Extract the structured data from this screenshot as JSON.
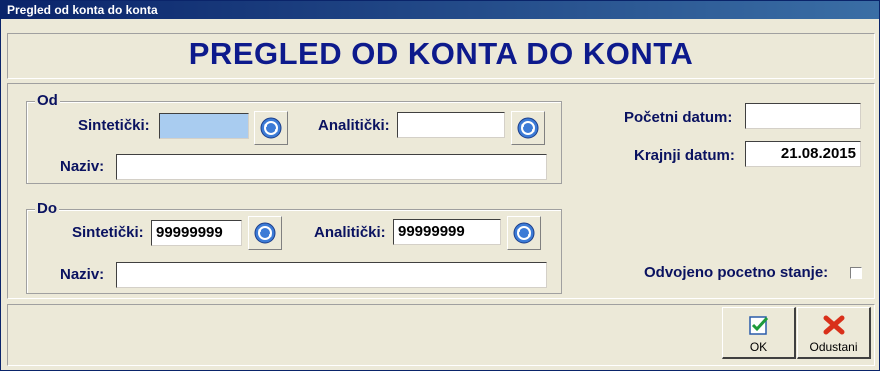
{
  "window": {
    "title": "Pregled od konta do konta"
  },
  "header": {
    "title": "PREGLED OD KONTA DO KONTA"
  },
  "od": {
    "legend": "Od",
    "sinteticki_label": "Sintetički:",
    "sinteticki_value": "",
    "analiticki_label": "Analitički:",
    "analiticki_value": "",
    "naziv_label": "Naziv:",
    "naziv_value": ""
  },
  "do": {
    "legend": "Do",
    "sinteticki_label": "Sintetički:",
    "sinteticki_value": "99999999",
    "analiticki_label": "Analitički:",
    "analiticki_value": "99999999",
    "naziv_label": "Naziv:",
    "naziv_value": ""
  },
  "dates": {
    "pocetni_label": "Početni datum:",
    "pocetni_value": "",
    "krajnji_label": "Krajnji datum:",
    "krajnji_value": "21.08.2015"
  },
  "options": {
    "odvojeno_label": "Odvojeno pocetno stanje:",
    "odvojeno_checked": false
  },
  "buttons": {
    "ok_label": "OK",
    "cancel_label": "Odustani"
  },
  "icons": {
    "lookup": "refresh-lookup-icon",
    "ok": "checkmark-icon",
    "cancel": "red-x-icon"
  },
  "colors": {
    "title_bar": "#0A246A",
    "heading": "#0D1A8C",
    "highlight_field": "#A9CCF0",
    "background": "#ECE9D8"
  }
}
